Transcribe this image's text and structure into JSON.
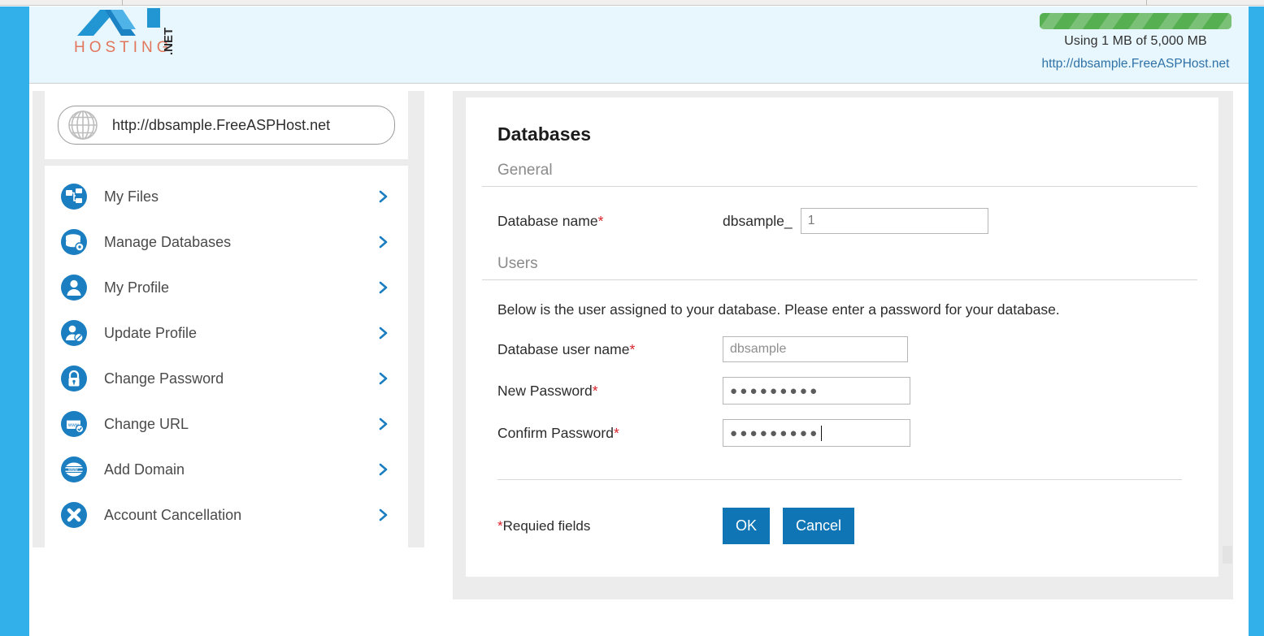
{
  "header": {
    "logo_text": "HOSTING",
    "logo_suffix": ".NET",
    "usage_text": "Using 1 MB of 5,000 MB",
    "usage_percent": 100,
    "site_link": "http://dbsample.FreeASPHost.net",
    "bar_color": "#56af51",
    "header_bg": "#e8f7fd",
    "accent_color": "#32b0ea"
  },
  "sidebar": {
    "url_value": "http://dbsample.FreeASPHost.net",
    "url_icon": "globe-icon",
    "items": [
      {
        "label": "My Files",
        "icon": "files-tree-icon"
      },
      {
        "label": "Manage Databases",
        "icon": "database-gear-icon"
      },
      {
        "label": "My Profile",
        "icon": "user-icon"
      },
      {
        "label": "Update Profile",
        "icon": "user-edit-icon"
      },
      {
        "label": "Change Password",
        "icon": "lock-icon"
      },
      {
        "label": "Change URL",
        "icon": "browser-window-icon"
      },
      {
        "label": "Add Domain",
        "icon": "www-globe-icon"
      },
      {
        "label": "Account Cancellation",
        "icon": "close-x-icon"
      }
    ]
  },
  "main": {
    "title": "Databases",
    "sections": {
      "general": {
        "heading": "General",
        "db_name_label": "Database name",
        "db_name_prefix": "dbsample_",
        "db_name_value": "1"
      },
      "users": {
        "heading": "Users",
        "help": "Below is the user assigned to your database. Please enter a password for your database.",
        "user_label": "Database user name",
        "user_value": "dbsample",
        "new_pw_label": "New Password",
        "new_pw_masked": "●●●●●●●●●",
        "confirm_pw_label": "Confirm Password",
        "confirm_pw_masked": "●●●●●●●●●"
      }
    },
    "required_marker": "*",
    "required_note_star": "*",
    "required_note": "Requied fields",
    "ok_label": "OK",
    "cancel_label": "Cancel",
    "button_color": "#0f75b5"
  }
}
